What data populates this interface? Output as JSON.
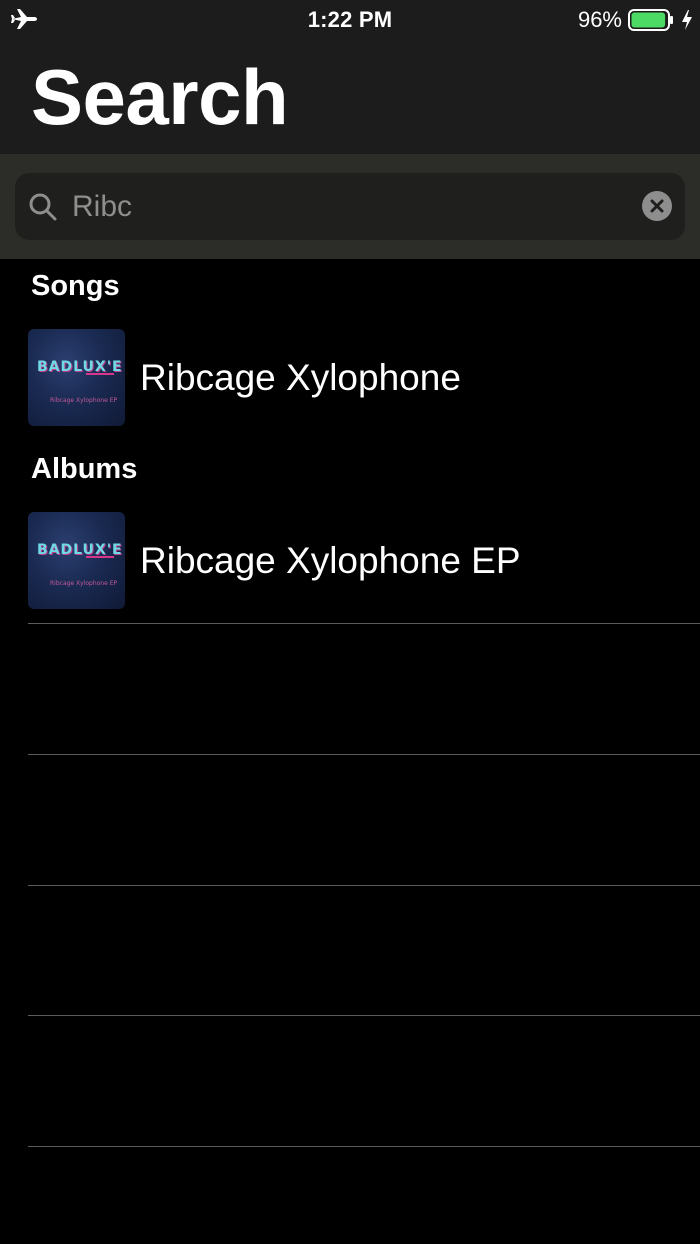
{
  "status_bar": {
    "time": "1:22 PM",
    "battery_percent": "96%",
    "battery_level": 0.96,
    "airplane_icon": "airplane-icon",
    "battery_icon": "battery-icon",
    "charging_icon": "charging-bolt-icon"
  },
  "header": {
    "title": "Search"
  },
  "search": {
    "value": "Ribc",
    "icon": "search-icon",
    "clear_icon": "clear-icon"
  },
  "sections": {
    "songs": {
      "label": "Songs",
      "items": [
        {
          "title": "Ribcage Xylophone",
          "art_logo": "BADLUX'E",
          "art_caption": "Ribcage Xylophone EP"
        }
      ]
    },
    "albums": {
      "label": "Albums",
      "items": [
        {
          "title": "Ribcage Xylophone EP",
          "art_logo": "BADLUX'E",
          "art_caption": "Ribcage Xylophone EP"
        }
      ]
    }
  },
  "colors": {
    "background": "#000000",
    "header_background": "#1c1c1c",
    "search_area": "#2c2d28",
    "search_field": "#1f1f1d",
    "placeholder_text": "#8e8e8e",
    "battery_green": "#4cd964"
  }
}
